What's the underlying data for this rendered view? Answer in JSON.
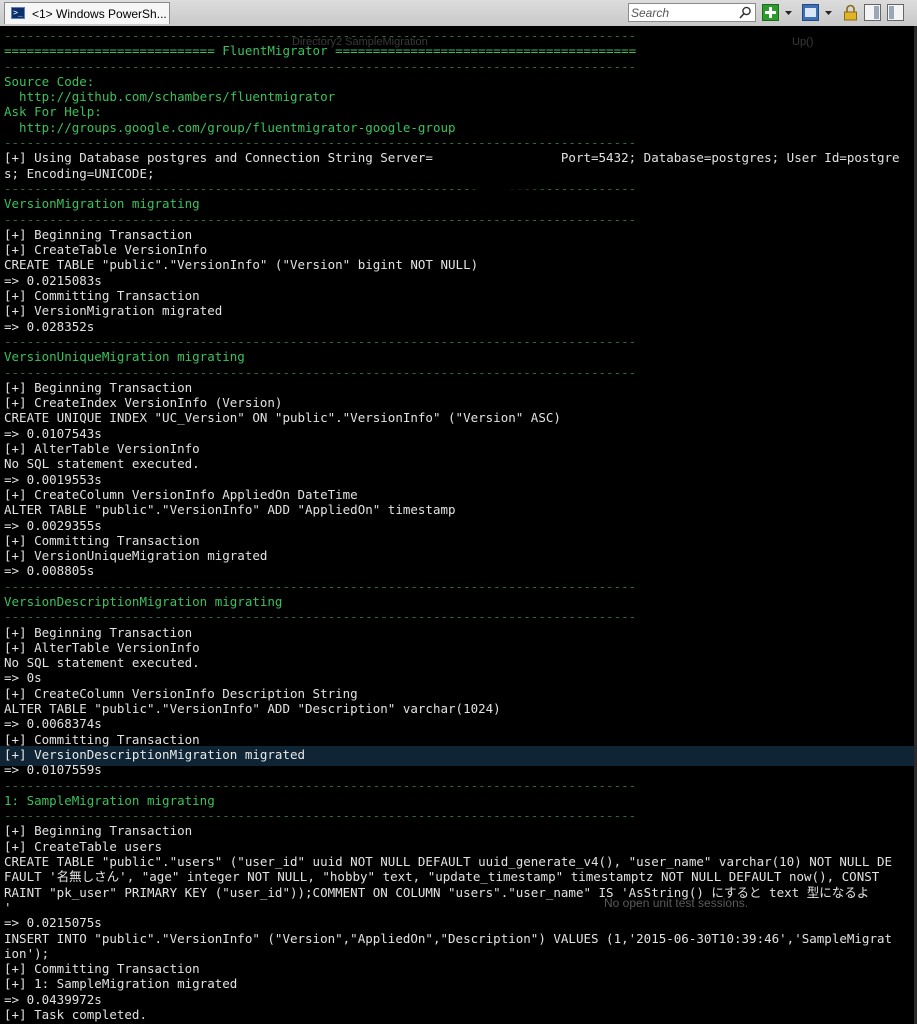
{
  "tab": {
    "title": "<1> Windows PowerSh..."
  },
  "search": {
    "placeholder": "Search"
  },
  "toolbar": {
    "icons": [
      "search-icon",
      "add-icon",
      "dropdown-icon",
      "window-icon",
      "dropdown-icon",
      "lock-icon",
      "panel-icon",
      "panel-icon"
    ]
  },
  "background_ghost": {
    "tab_text": "Directory2 SampleMigration",
    "method_text": "Up()",
    "status_text": "No open unit test sessions."
  },
  "console": {
    "lines": [
      {
        "t": "------------------------------------------------------------------------------------",
        "c": "dg"
      },
      {
        "t": "============================ FluentMigrator ========================================",
        "c": "g"
      },
      {
        "t": "------------------------------------------------------------------------------------",
        "c": "dg"
      },
      {
        "t": "Source Code:",
        "c": "g"
      },
      {
        "t": "  http://github.com/schambers/fluentmigrator",
        "c": "g"
      },
      {
        "t": "Ask For Help:",
        "c": "g"
      },
      {
        "t": "  http://groups.google.com/group/fluentmigrator-google-group",
        "c": "g"
      },
      {
        "t": "------------------------------------------------------------------------------------",
        "c": "dg"
      },
      {
        "t": "[+] Using Database postgres and Connection String Server=                 Port=5432; Database=postgres; User Id=postgre",
        "c": "w"
      },
      {
        "t": "s; Encoding=UNICODE;",
        "c": "w"
      },
      {
        "t": "------------------------------------------------------------------------------------",
        "c": "dg"
      },
      {
        "t": "VersionMigration migrating",
        "c": "g"
      },
      {
        "t": "------------------------------------------------------------------------------------",
        "c": "dg"
      },
      {
        "t": "[+] Beginning Transaction",
        "c": "w"
      },
      {
        "t": "[+] CreateTable VersionInfo",
        "c": "w"
      },
      {
        "t": "CREATE TABLE \"public\".\"VersionInfo\" (\"Version\" bigint NOT NULL)",
        "c": "w"
      },
      {
        "t": "=> 0.0215083s",
        "c": "w"
      },
      {
        "t": "[+] Committing Transaction",
        "c": "w"
      },
      {
        "t": "[+] VersionMigration migrated",
        "c": "w"
      },
      {
        "t": "=> 0.028352s",
        "c": "w"
      },
      {
        "t": "------------------------------------------------------------------------------------",
        "c": "dg"
      },
      {
        "t": "VersionUniqueMigration migrating",
        "c": "g"
      },
      {
        "t": "------------------------------------------------------------------------------------",
        "c": "dg"
      },
      {
        "t": "[+] Beginning Transaction",
        "c": "w"
      },
      {
        "t": "[+] CreateIndex VersionInfo (Version)",
        "c": "w"
      },
      {
        "t": "CREATE UNIQUE INDEX \"UC_Version\" ON \"public\".\"VersionInfo\" (\"Version\" ASC)",
        "c": "w"
      },
      {
        "t": "=> 0.0107543s",
        "c": "w"
      },
      {
        "t": "[+] AlterTable VersionInfo",
        "c": "w"
      },
      {
        "t": "No SQL statement executed.",
        "c": "w"
      },
      {
        "t": "=> 0.0019553s",
        "c": "w"
      },
      {
        "t": "[+] CreateColumn VersionInfo AppliedOn DateTime",
        "c": "w"
      },
      {
        "t": "ALTER TABLE \"public\".\"VersionInfo\" ADD \"AppliedOn\" timestamp",
        "c": "w"
      },
      {
        "t": "=> 0.0029355s",
        "c": "w"
      },
      {
        "t": "[+] Committing Transaction",
        "c": "w"
      },
      {
        "t": "[+] VersionUniqueMigration migrated",
        "c": "w"
      },
      {
        "t": "=> 0.008805s",
        "c": "w"
      },
      {
        "t": "------------------------------------------------------------------------------------",
        "c": "dg"
      },
      {
        "t": "VersionDescriptionMigration migrating",
        "c": "g"
      },
      {
        "t": "------------------------------------------------------------------------------------",
        "c": "dg"
      },
      {
        "t": "[+] Beginning Transaction",
        "c": "w"
      },
      {
        "t": "[+] AlterTable VersionInfo",
        "c": "w"
      },
      {
        "t": "No SQL statement executed.",
        "c": "w"
      },
      {
        "t": "=> 0s",
        "c": "w"
      },
      {
        "t": "[+] CreateColumn VersionInfo Description String",
        "c": "w"
      },
      {
        "t": "ALTER TABLE \"public\".\"VersionInfo\" ADD \"Description\" varchar(1024)",
        "c": "w"
      },
      {
        "t": "=> 0.0068374s",
        "c": "w"
      },
      {
        "t": "[+] Committing Transaction",
        "c": "w"
      },
      {
        "t": "[+] VersionDescriptionMigration migrated",
        "c": "hl"
      },
      {
        "t": "=> 0.0107559s",
        "c": "w"
      },
      {
        "t": "------------------------------------------------------------------------------------",
        "c": "dg"
      },
      {
        "t": "1: SampleMigration migrating",
        "c": "g"
      },
      {
        "t": "------------------------------------------------------------------------------------",
        "c": "dg"
      },
      {
        "t": "[+] Beginning Transaction",
        "c": "w"
      },
      {
        "t": "[+] CreateTable users",
        "c": "w"
      },
      {
        "t": "CREATE TABLE \"public\".\"users\" (\"user_id\" uuid NOT NULL DEFAULT uuid_generate_v4(), \"user_name\" varchar(10) NOT NULL DE",
        "c": "w"
      },
      {
        "t": "FAULT '名無しさん', \"age\" integer NOT NULL, \"hobby\" text, \"update_timestamp\" timestamptz NOT NULL DEFAULT now(), CONST",
        "c": "w"
      },
      {
        "t": "RAINT \"pk_user\" PRIMARY KEY (\"user_id\"));COMMENT ON COLUMN \"users\".\"user_name\" IS 'AsString() にすると text 型になるよ",
        "c": "w"
      },
      {
        "t": "'",
        "c": "w"
      },
      {
        "t": "=> 0.0215075s",
        "c": "w"
      },
      {
        "t": "INSERT INTO \"public\".\"VersionInfo\" (\"Version\",\"AppliedOn\",\"Description\") VALUES (1,'2015-06-30T10:39:46','SampleMigrat",
        "c": "w"
      },
      {
        "t": "ion');",
        "c": "w"
      },
      {
        "t": "[+] Committing Transaction",
        "c": "w"
      },
      {
        "t": "[+] 1: SampleMigration migrated",
        "c": "w"
      },
      {
        "t": "=> 0.0439972s",
        "c": "w"
      },
      {
        "t": "[+] Task completed.",
        "c": "w"
      }
    ]
  }
}
